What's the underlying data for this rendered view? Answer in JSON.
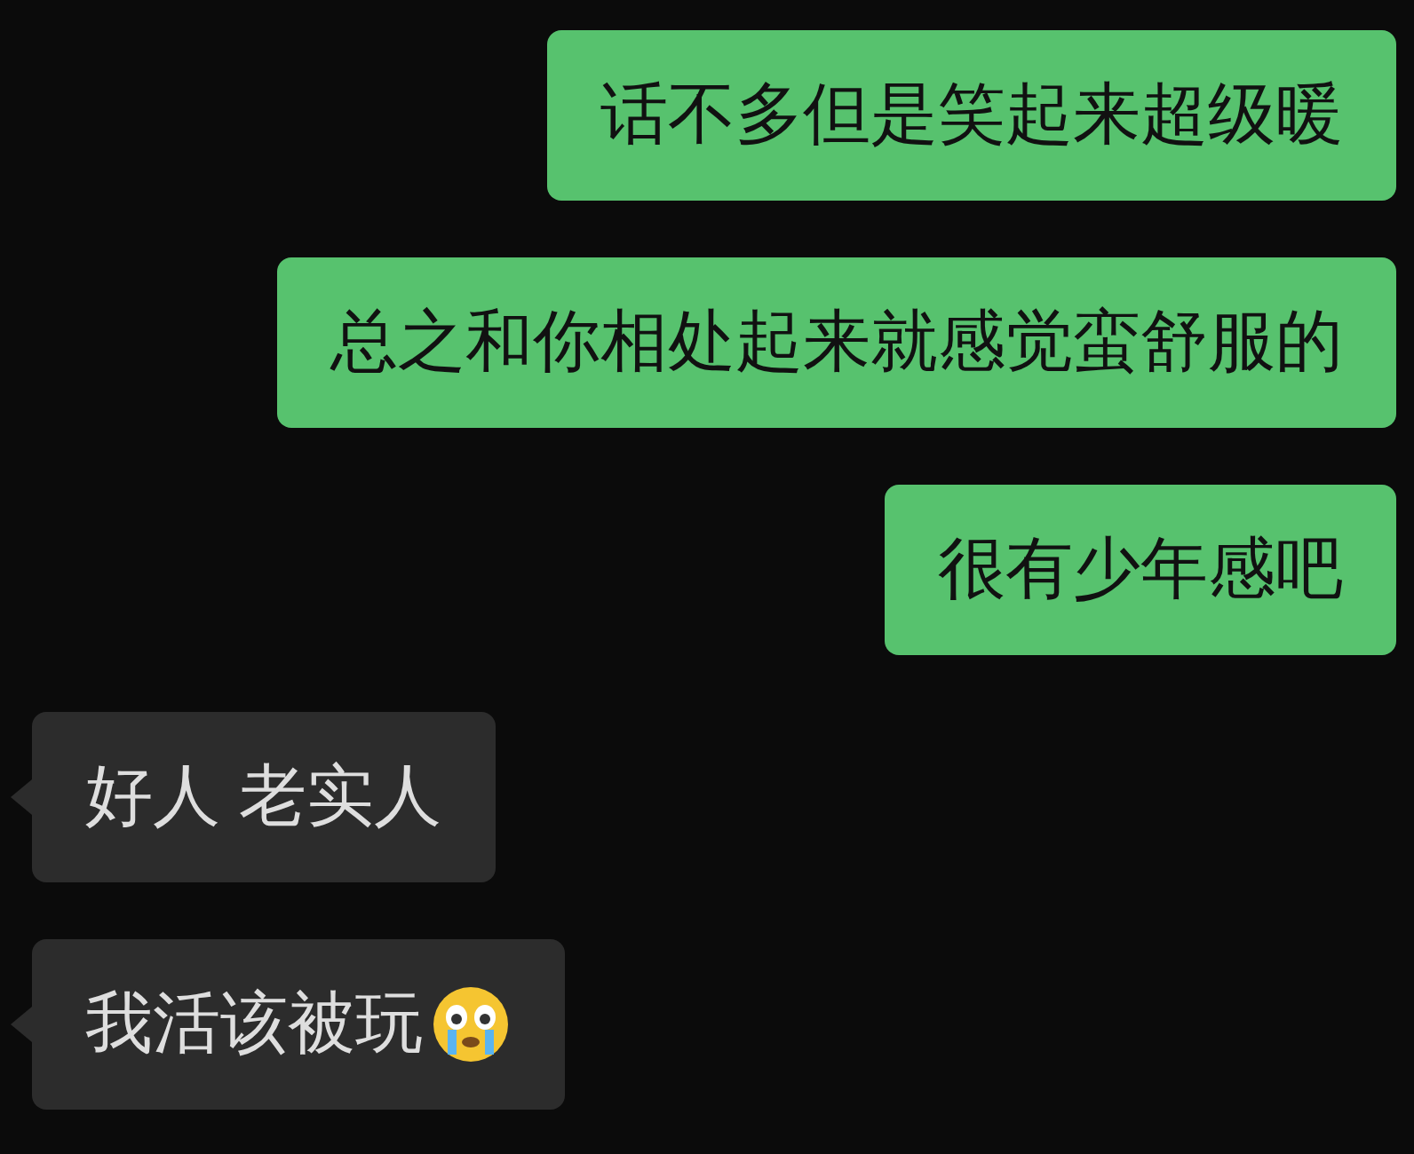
{
  "messages": [
    {
      "sent": true,
      "kind": "text",
      "text": "话不多但是笑起来超级暖"
    },
    {
      "sent": true,
      "kind": "text",
      "text": "总之和你相处起来就感觉蛮舒服的"
    },
    {
      "sent": true,
      "kind": "text",
      "text": "很有少年感吧"
    },
    {
      "sent": false,
      "kind": "text",
      "text": "好人 老实人"
    },
    {
      "sent": false,
      "kind": "text_with_emoji",
      "text": "我活该被玩"
    }
  ]
}
